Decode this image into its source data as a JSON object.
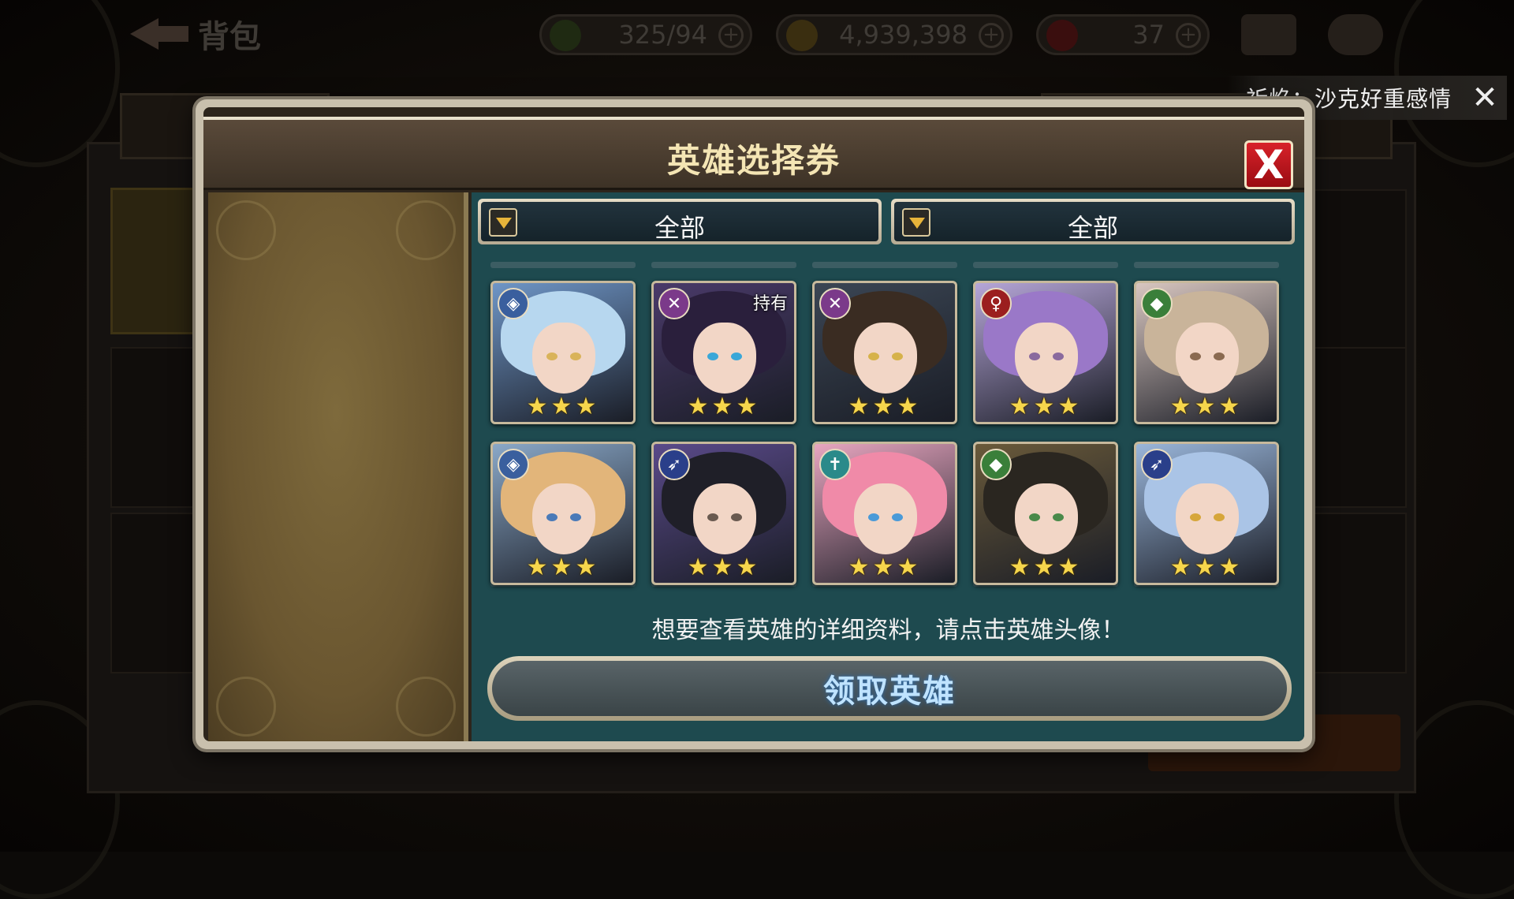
{
  "topbar": {
    "back_label": "背包",
    "stamina": "325/94",
    "gold": "4,939,398",
    "gems": "37"
  },
  "notification": {
    "text": "祈焰：沙克好重感情"
  },
  "modal": {
    "title": "英雄选择券",
    "filter_left": "全部",
    "filter_right": "全部",
    "hint": "想要查看英雄的详细资料，请点击英雄头像！",
    "claim_label": "领取英雄",
    "heroes": [
      {
        "class_icon": "shield-icon",
        "class_color": "#3a5f9e",
        "stars": "★★★",
        "owned": "",
        "hair": "#b7d7ef",
        "bg": "#6f96c7",
        "eye": "#d9b35a"
      },
      {
        "class_icon": "crossed-swords-icon",
        "class_color": "#7b3a8a",
        "stars": "★★★",
        "owned": "持有",
        "hair": "#2a1f3c",
        "bg": "#4a3a6a",
        "eye": "#3aa7d8"
      },
      {
        "class_icon": "crossed-swords-icon",
        "class_color": "#7b3a8a",
        "stars": "★★★",
        "owned": "",
        "hair": "#3a2c22",
        "bg": "#3b4654",
        "eye": "#d6b24a"
      },
      {
        "class_icon": "staff-icon",
        "class_color": "#9b1f1f",
        "stars": "★★★",
        "owned": "",
        "hair": "#9a78c8",
        "bg": "#b6a6d8",
        "eye": "#8a6a9e"
      },
      {
        "class_icon": "bow-icon",
        "class_color": "#3a7f3a",
        "stars": "★★★",
        "owned": "",
        "hair": "#c9b49a",
        "bg": "#d8c6c0",
        "eye": "#8a6a50"
      },
      {
        "class_icon": "shield-icon",
        "class_color": "#3a5f9e",
        "stars": "★★★",
        "owned": "",
        "hair": "#e2b57a",
        "bg": "#8aa8c8",
        "eye": "#4a7ab8"
      },
      {
        "class_icon": "gun-icon",
        "class_color": "#2a3f8a",
        "stars": "★★★",
        "owned": "",
        "hair": "#1f1f28",
        "bg": "#5a4a8a",
        "eye": "#6a5a50"
      },
      {
        "class_icon": "cross-icon",
        "class_color": "#2a8a8a",
        "stars": "★★★",
        "owned": "",
        "hair": "#f08aa8",
        "bg": "#e8a6c0",
        "eye": "#4a9ad8"
      },
      {
        "class_icon": "bow-icon",
        "class_color": "#3a7f3a",
        "stars": "★★★",
        "owned": "",
        "hair": "#2a2620",
        "bg": "#6a5a3a",
        "eye": "#4a8a4a"
      },
      {
        "class_icon": "gun-icon",
        "class_color": "#2a3f8a",
        "stars": "★★★",
        "owned": "",
        "hair": "#aac4e6",
        "bg": "#9ab6da",
        "eye": "#d6a63a"
      }
    ]
  }
}
